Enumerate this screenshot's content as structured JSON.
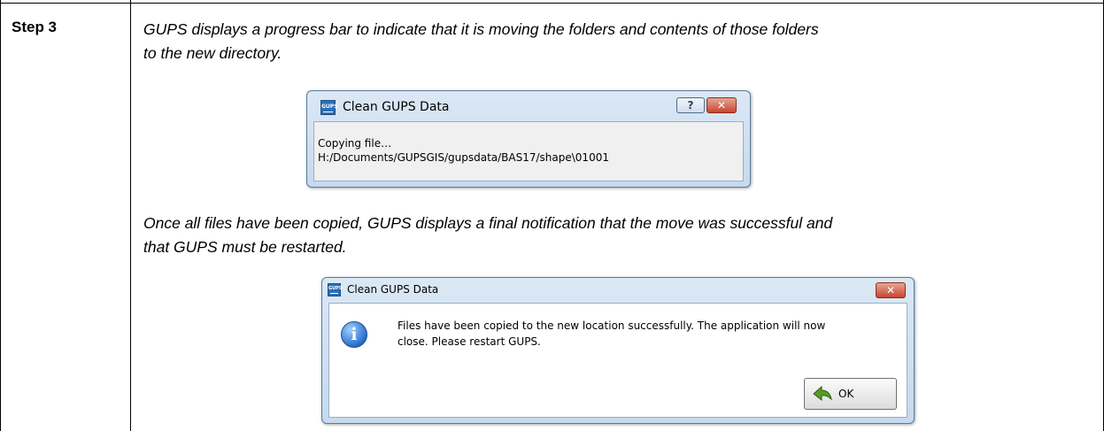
{
  "step": {
    "label": "Step 3"
  },
  "paragraphs": {
    "p1_line1": "GUPS displays a progress bar to indicate that it is moving the folders and contents of those folders",
    "p1_line2": "to the new directory.",
    "p2_line1": "Once all files have been copied, GUPS displays a final notification that the move was successful and",
    "p2_line2": "that GUPS must be restarted."
  },
  "dialog1": {
    "icon_label": "GUPS",
    "title": "Clean GUPS Data",
    "help_glyph": "?",
    "close_glyph": "✕",
    "status_line": "Copying file…",
    "path_line": "H:/Documents/GUPSGIS/gupsdata/BAS17/shape\\01001"
  },
  "dialog2": {
    "icon_label": "GUPS",
    "title": "Clean GUPS Data",
    "close_glyph": "✕",
    "info_glyph": "i",
    "message_line1": "Files have been copied to the new location successfully. The application will now",
    "message_line2": "close. Please restart GUPS.",
    "ok_label": "OK"
  },
  "colors": {
    "titlebar": "#c6d9ee",
    "close_button": "#c8452d",
    "info_icon": "#2a6fcc",
    "ok_arrow": "#5a9a2a"
  }
}
